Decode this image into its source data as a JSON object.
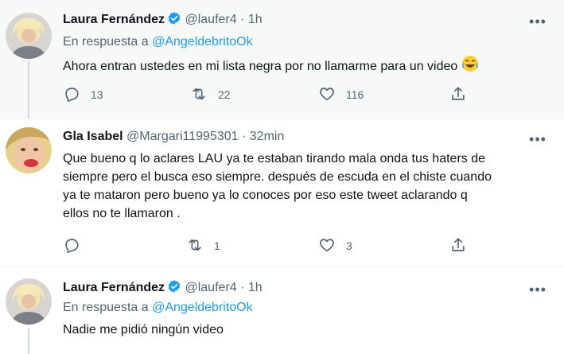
{
  "tweets": [
    {
      "name": "Laura Fernández",
      "handle": "@laufer4",
      "separator": "·",
      "time": "1h",
      "reply_prefix": "En respuesta a",
      "reply_to": "@AngeldebritoOk",
      "text": "Ahora entran ustedes en mi lista negra por no llamarme para un video",
      "emoji_icon": "laughing-crying-emoji",
      "replies": "13",
      "retweets": "22",
      "likes": "116"
    },
    {
      "name": "Gla Isabel",
      "handle": "@Margari11995301",
      "separator": "·",
      "time": "32min",
      "text_lines": [
        "Que bueno q lo aclares LAU  ya te estaban tirando mala onda tus haters de",
        "siempre pero el busca eso siempre. después de escuda en el chiste  cuando",
        "ya te mataron pero bueno ya lo conoces por eso este tweet aclarando  q",
        "ellos no te llamaron ."
      ],
      "retweets": "1",
      "likes": "3"
    },
    {
      "name": "Laura Fernández",
      "handle": "@laufer4",
      "separator": "·",
      "time": "1h",
      "reply_prefix": "En respuesta a",
      "reply_to": "@AngeldebritoOk",
      "text": "Nadie me pidió ningún video"
    }
  ],
  "more_label": "•••",
  "colors": {
    "accent": "#1d9bf0",
    "secondary_text": "#536471",
    "highlight_bg": "#f7f9f9"
  }
}
